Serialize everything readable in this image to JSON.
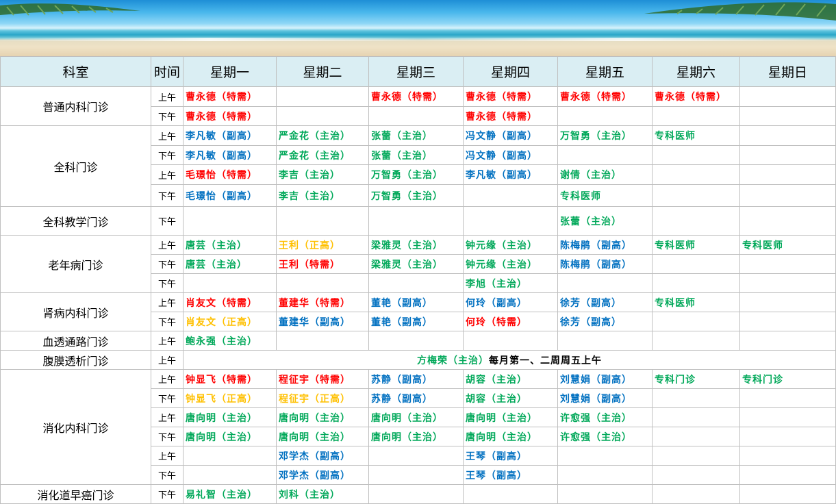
{
  "colors": {
    "red": "#ff0000",
    "blue": "#0070c0",
    "green": "#00a859",
    "orange": "#ffc000",
    "header_bg": "#daeef3"
  },
  "header": {
    "dept": "科室",
    "time": "时间",
    "days": [
      "星期一",
      "星期二",
      "星期三",
      "星期四",
      "星期五",
      "星期六",
      "星期日"
    ]
  },
  "rows": [
    {
      "dept": "普通内科门诊",
      "time": "上午",
      "cells": [
        {
          "t": "曹永德（特需）",
          "c": "red"
        },
        {
          "t": "",
          "c": ""
        },
        {
          "t": "曹永德（特需）",
          "c": "red"
        },
        {
          "t": "曹永德（特需）",
          "c": "red"
        },
        {
          "t": "曹永德（特需）",
          "c": "red"
        },
        {
          "t": "曹永德（特需）",
          "c": "red"
        },
        {
          "t": "",
          "c": ""
        }
      ]
    },
    {
      "dept": "",
      "time": "下午",
      "cells": [
        {
          "t": "曹永德（特需）",
          "c": "red"
        },
        {
          "t": "",
          "c": ""
        },
        {
          "t": "",
          "c": ""
        },
        {
          "t": "曹永德（特需）",
          "c": "red"
        },
        {
          "t": "",
          "c": ""
        },
        {
          "t": "",
          "c": ""
        },
        {
          "t": "",
          "c": ""
        }
      ]
    },
    {
      "dept": "全科门诊",
      "time": "上午",
      "cells": [
        {
          "t": "李凡敏（副高）",
          "c": "blue"
        },
        {
          "t": "严金花（主治）",
          "c": "green"
        },
        {
          "t": "张蕾（主治）",
          "c": "green"
        },
        {
          "t": "冯文静（副高）",
          "c": "blue"
        },
        {
          "t": "万智勇（主治）",
          "c": "green"
        },
        {
          "t": "专科医师",
          "c": "green"
        },
        {
          "t": "",
          "c": ""
        }
      ]
    },
    {
      "dept": "",
      "time": "下午",
      "cells": [
        {
          "t": "李凡敏（副高）",
          "c": "blue"
        },
        {
          "t": "严金花（主治）",
          "c": "green"
        },
        {
          "t": "张蕾（主治）",
          "c": "green"
        },
        {
          "t": "冯文静（副高）",
          "c": "blue"
        },
        {
          "t": "",
          "c": ""
        },
        {
          "t": "",
          "c": ""
        },
        {
          "t": "",
          "c": ""
        }
      ]
    },
    {
      "dept": "",
      "time": "上午",
      "cells": [
        {
          "t": "毛璟怡（特需）",
          "c": "red"
        },
        {
          "t": "李吉（主治）",
          "c": "green"
        },
        {
          "t": "万智勇（主治）",
          "c": "green"
        },
        {
          "t": "李凡敏（副高）",
          "c": "blue"
        },
        {
          "t": "谢倩（主治）",
          "c": "green"
        },
        {
          "t": "",
          "c": ""
        },
        {
          "t": "",
          "c": ""
        }
      ]
    },
    {
      "dept": "",
      "time": "下午",
      "cells": [
        {
          "t": "毛璟怡（副高）",
          "c": "blue"
        },
        {
          "t": "李吉（主治）",
          "c": "green"
        },
        {
          "t": "万智勇（主治）",
          "c": "green"
        },
        {
          "t": "",
          "c": ""
        },
        {
          "t": "专科医师",
          "c": "green"
        },
        {
          "t": "",
          "c": ""
        },
        {
          "t": "",
          "c": ""
        }
      ]
    },
    {
      "dept": "全科教学门诊",
      "time": "下午",
      "cells": [
        {
          "t": "",
          "c": ""
        },
        {
          "t": "",
          "c": ""
        },
        {
          "t": "",
          "c": ""
        },
        {
          "t": "",
          "c": ""
        },
        {
          "t": "张蕾（主治）",
          "c": "green"
        },
        {
          "t": "",
          "c": ""
        },
        {
          "t": "",
          "c": ""
        }
      ]
    },
    {
      "dept": "老年病门诊",
      "time": "上午",
      "cells": [
        {
          "t": "唐芸（主治）",
          "c": "green"
        },
        {
          "t": "王利（正高）",
          "c": "orange"
        },
        {
          "t": "梁雅灵（主治）",
          "c": "green"
        },
        {
          "t": "钟元缘（主治）",
          "c": "green"
        },
        {
          "t": "陈梅鹃（副高）",
          "c": "blue"
        },
        {
          "t": "专科医师",
          "c": "green"
        },
        {
          "t": "专科医师",
          "c": "green"
        }
      ]
    },
    {
      "dept": "",
      "time": "下午",
      "cells": [
        {
          "t": "唐芸（主治）",
          "c": "green"
        },
        {
          "t": "王利（特需）",
          "c": "red"
        },
        {
          "t": "梁雅灵（主治）",
          "c": "green"
        },
        {
          "t": "钟元缘（主治）",
          "c": "green"
        },
        {
          "t": "陈梅鹃（副高）",
          "c": "blue"
        },
        {
          "t": "",
          "c": ""
        },
        {
          "t": "",
          "c": ""
        }
      ]
    },
    {
      "dept": "",
      "time": "下午",
      "cells": [
        {
          "t": "",
          "c": ""
        },
        {
          "t": "",
          "c": ""
        },
        {
          "t": "",
          "c": ""
        },
        {
          "t": "李旭（主治）",
          "c": "green"
        },
        {
          "t": "",
          "c": ""
        },
        {
          "t": "",
          "c": ""
        },
        {
          "t": "",
          "c": ""
        }
      ]
    },
    {
      "dept": "肾病内科门诊",
      "time": "上午",
      "cells": [
        {
          "t": "肖友文（特需）",
          "c": "red"
        },
        {
          "t": "董建华（特需）",
          "c": "red"
        },
        {
          "t": "董艳（副高）",
          "c": "blue"
        },
        {
          "t": "何玲（副高）",
          "c": "blue"
        },
        {
          "t": "徐芳（副高）",
          "c": "blue"
        },
        {
          "t": "专科医师",
          "c": "green"
        },
        {
          "t": "",
          "c": ""
        }
      ]
    },
    {
      "dept": "",
      "time": "下午",
      "cells": [
        {
          "t": "肖友文（正高）",
          "c": "orange"
        },
        {
          "t": "董建华（副高）",
          "c": "blue"
        },
        {
          "t": "董艳（副高）",
          "c": "blue"
        },
        {
          "t": "何玲（特需）",
          "c": "red"
        },
        {
          "t": "徐芳（副高）",
          "c": "blue"
        },
        {
          "t": "",
          "c": ""
        },
        {
          "t": "",
          "c": ""
        }
      ]
    },
    {
      "dept": "血透通路门诊",
      "time": "上午",
      "cells": [
        {
          "t": "鲍永强（主治）",
          "c": "green"
        },
        {
          "t": "",
          "c": ""
        },
        {
          "t": "",
          "c": ""
        },
        {
          "t": "",
          "c": ""
        },
        {
          "t": "",
          "c": ""
        },
        {
          "t": "",
          "c": ""
        },
        {
          "t": "",
          "c": ""
        }
      ]
    },
    {
      "dept": "腹膜透析门诊",
      "time": "上午",
      "notice": {
        "doctor": "方梅荣（主治）",
        "text": "每月第一、二周周五上午"
      }
    },
    {
      "dept": "消化内科门诊",
      "time": "上午",
      "cells": [
        {
          "t": "钟显飞（特需）",
          "c": "red"
        },
        {
          "t": "程征宇（特需）",
          "c": "red"
        },
        {
          "t": "苏静（副高）",
          "c": "blue"
        },
        {
          "t": "胡容（主治）",
          "c": "green"
        },
        {
          "t": "刘慧娟（副高）",
          "c": "blue"
        },
        {
          "t": "专科门诊",
          "c": "green"
        },
        {
          "t": "专科门诊",
          "c": "green"
        }
      ]
    },
    {
      "dept": "",
      "time": "下午",
      "cells": [
        {
          "t": "钟显飞（正高）",
          "c": "orange"
        },
        {
          "t": "程征宇（正高）",
          "c": "orange"
        },
        {
          "t": "苏静（副高）",
          "c": "blue"
        },
        {
          "t": "胡容（主治）",
          "c": "green"
        },
        {
          "t": "刘慧娟（副高）",
          "c": "blue"
        },
        {
          "t": "",
          "c": ""
        },
        {
          "t": "",
          "c": ""
        }
      ]
    },
    {
      "dept": "",
      "time": "上午",
      "cells": [
        {
          "t": "唐向明（主治）",
          "c": "green"
        },
        {
          "t": "唐向明（主治）",
          "c": "green"
        },
        {
          "t": "唐向明（主治）",
          "c": "green"
        },
        {
          "t": "唐向明（主治）",
          "c": "green"
        },
        {
          "t": "许愈强（主治）",
          "c": "green"
        },
        {
          "t": "",
          "c": ""
        },
        {
          "t": "",
          "c": ""
        }
      ]
    },
    {
      "dept": "",
      "time": "下午",
      "cells": [
        {
          "t": "唐向明（主治）",
          "c": "green"
        },
        {
          "t": "唐向明（主治）",
          "c": "green"
        },
        {
          "t": "唐向明（主治）",
          "c": "green"
        },
        {
          "t": "唐向明（主治）",
          "c": "green"
        },
        {
          "t": "许愈强（主治）",
          "c": "green"
        },
        {
          "t": "",
          "c": ""
        },
        {
          "t": "",
          "c": ""
        }
      ]
    },
    {
      "dept": "",
      "time": "上午",
      "cells": [
        {
          "t": "",
          "c": ""
        },
        {
          "t": "邓学杰（副高）",
          "c": "blue"
        },
        {
          "t": "",
          "c": ""
        },
        {
          "t": "王琴（副高）",
          "c": "blue"
        },
        {
          "t": "",
          "c": ""
        },
        {
          "t": "",
          "c": ""
        },
        {
          "t": "",
          "c": ""
        }
      ]
    },
    {
      "dept": "",
      "time": "下午",
      "cells": [
        {
          "t": "",
          "c": ""
        },
        {
          "t": "邓学杰（副高）",
          "c": "blue"
        },
        {
          "t": "",
          "c": ""
        },
        {
          "t": "王琴（副高）",
          "c": "blue"
        },
        {
          "t": "",
          "c": ""
        },
        {
          "t": "",
          "c": ""
        },
        {
          "t": "",
          "c": ""
        }
      ]
    },
    {
      "dept": "消化道早癌门诊",
      "time": "下午",
      "cells": [
        {
          "t": "易礼智（主治）",
          "c": "green"
        },
        {
          "t": "刘科（主治）",
          "c": "green"
        },
        {
          "t": "",
          "c": ""
        },
        {
          "t": "",
          "c": ""
        },
        {
          "t": "",
          "c": ""
        },
        {
          "t": "",
          "c": ""
        },
        {
          "t": "",
          "c": ""
        }
      ]
    }
  ]
}
